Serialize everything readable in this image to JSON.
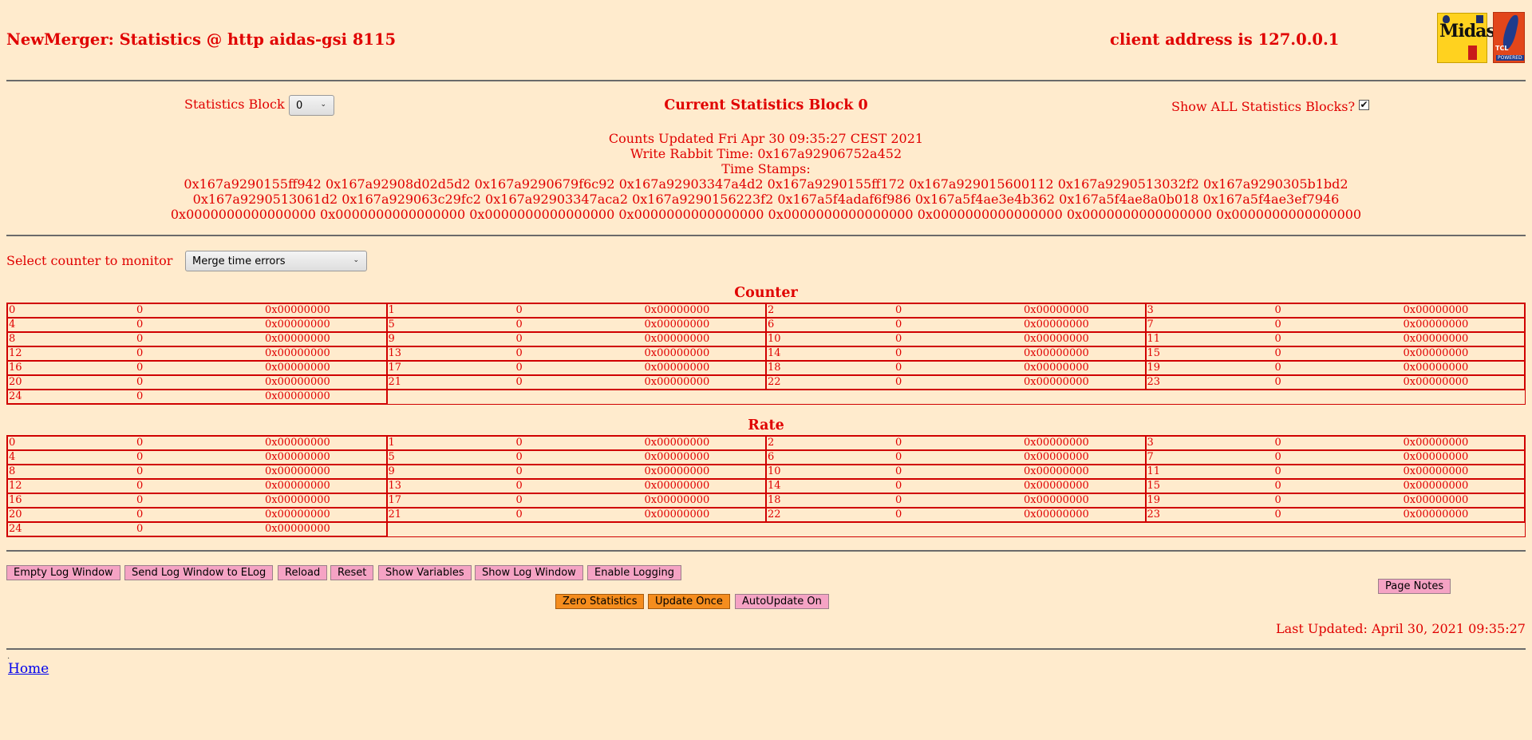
{
  "header": {
    "title": "NewMerger: Statistics @ http aidas-gsi 8115",
    "client": "client address is 127.0.0.1",
    "midas_logo_text": "Midas",
    "tcl_logo_text": "TCL",
    "tcl_powered_text": "POWERED"
  },
  "stats": {
    "block_label": "Statistics Block",
    "block_value": "0",
    "block_options": [
      "0"
    ],
    "current_block": "Current Statistics Block 0",
    "show_all_label": "Show ALL Statistics Blocks?",
    "show_all_checked": true,
    "counts_updated": "Counts Updated Fri Apr 30 09:35:27 CEST 2021",
    "write_rabbit": "Write Rabbit Time: 0x167a92906752a452",
    "time_stamps_label": "Time Stamps:",
    "ts_line1": "0x167a9290155ff942 0x167a92908d02d5d2 0x167a9290679f6c92 0x167a92903347a4d2 0x167a9290155ff172 0x167a929015600112 0x167a9290513032f2 0x167a9290305b1bd2",
    "ts_line2": "0x167a9290513061d2 0x167a929063c29fc2 0x167a92903347aca2 0x167a9290156223f2 0x167a5f4adaf6f986 0x167a5f4ae3e4b362 0x167a5f4ae8a0b018 0x167a5f4ae3ef7946",
    "ts_line3": "0x0000000000000000 0x0000000000000000 0x0000000000000000 0x0000000000000000 0x0000000000000000 0x0000000000000000 0x0000000000000000 0x0000000000000000"
  },
  "monitor": {
    "label": "Select counter to monitor",
    "value": "Merge time errors",
    "options": [
      "Merge time errors"
    ]
  },
  "counter": {
    "heading": "Counter",
    "cells": [
      [
        "0",
        "0",
        "0x00000000"
      ],
      [
        "1",
        "0",
        "0x00000000"
      ],
      [
        "2",
        "0",
        "0x00000000"
      ],
      [
        "3",
        "0",
        "0x00000000"
      ],
      [
        "4",
        "0",
        "0x00000000"
      ],
      [
        "5",
        "0",
        "0x00000000"
      ],
      [
        "6",
        "0",
        "0x00000000"
      ],
      [
        "7",
        "0",
        "0x00000000"
      ],
      [
        "8",
        "0",
        "0x00000000"
      ],
      [
        "9",
        "0",
        "0x00000000"
      ],
      [
        "10",
        "0",
        "0x00000000"
      ],
      [
        "11",
        "0",
        "0x00000000"
      ],
      [
        "12",
        "0",
        "0x00000000"
      ],
      [
        "13",
        "0",
        "0x00000000"
      ],
      [
        "14",
        "0",
        "0x00000000"
      ],
      [
        "15",
        "0",
        "0x00000000"
      ],
      [
        "16",
        "0",
        "0x00000000"
      ],
      [
        "17",
        "0",
        "0x00000000"
      ],
      [
        "18",
        "0",
        "0x00000000"
      ],
      [
        "19",
        "0",
        "0x00000000"
      ],
      [
        "20",
        "0",
        "0x00000000"
      ],
      [
        "21",
        "0",
        "0x00000000"
      ],
      [
        "22",
        "0",
        "0x00000000"
      ],
      [
        "23",
        "0",
        "0x00000000"
      ],
      [
        "24",
        "0",
        "0x00000000"
      ]
    ]
  },
  "rate": {
    "heading": "Rate",
    "cells": [
      [
        "0",
        "0",
        "0x00000000"
      ],
      [
        "1",
        "0",
        "0x00000000"
      ],
      [
        "2",
        "0",
        "0x00000000"
      ],
      [
        "3",
        "0",
        "0x00000000"
      ],
      [
        "4",
        "0",
        "0x00000000"
      ],
      [
        "5",
        "0",
        "0x00000000"
      ],
      [
        "6",
        "0",
        "0x00000000"
      ],
      [
        "7",
        "0",
        "0x00000000"
      ],
      [
        "8",
        "0",
        "0x00000000"
      ],
      [
        "9",
        "0",
        "0x00000000"
      ],
      [
        "10",
        "0",
        "0x00000000"
      ],
      [
        "11",
        "0",
        "0x00000000"
      ],
      [
        "12",
        "0",
        "0x00000000"
      ],
      [
        "13",
        "0",
        "0x00000000"
      ],
      [
        "14",
        "0",
        "0x00000000"
      ],
      [
        "15",
        "0",
        "0x00000000"
      ],
      [
        "16",
        "0",
        "0x00000000"
      ],
      [
        "17",
        "0",
        "0x00000000"
      ],
      [
        "18",
        "0",
        "0x00000000"
      ],
      [
        "19",
        "0",
        "0x00000000"
      ],
      [
        "20",
        "0",
        "0x00000000"
      ],
      [
        "21",
        "0",
        "0x00000000"
      ],
      [
        "22",
        "0",
        "0x00000000"
      ],
      [
        "23",
        "0",
        "0x00000000"
      ],
      [
        "24",
        "0",
        "0x00000000"
      ]
    ]
  },
  "buttons": {
    "empty_log": "Empty Log Window",
    "send_log": "Send Log Window to ELog",
    "reload": "Reload",
    "reset": "Reset",
    "show_vars": "Show Variables",
    "show_log": "Show Log Window",
    "enable_logging": "Enable Logging",
    "page_notes": "Page Notes",
    "zero_stats": "Zero Statistics",
    "update_once": "Update Once",
    "autoupdate": "AutoUpdate On"
  },
  "footer": {
    "last_updated": "Last Updated: April 30, 2021 09:35:27",
    "dot": ".",
    "home": "Home"
  },
  "colors": {
    "background": "#ffebcd",
    "text": "#e00000",
    "grid_border": "#d00000",
    "button_pink": "#f5a3c4",
    "button_orange": "#f58d1e",
    "link": "#0000ee"
  }
}
